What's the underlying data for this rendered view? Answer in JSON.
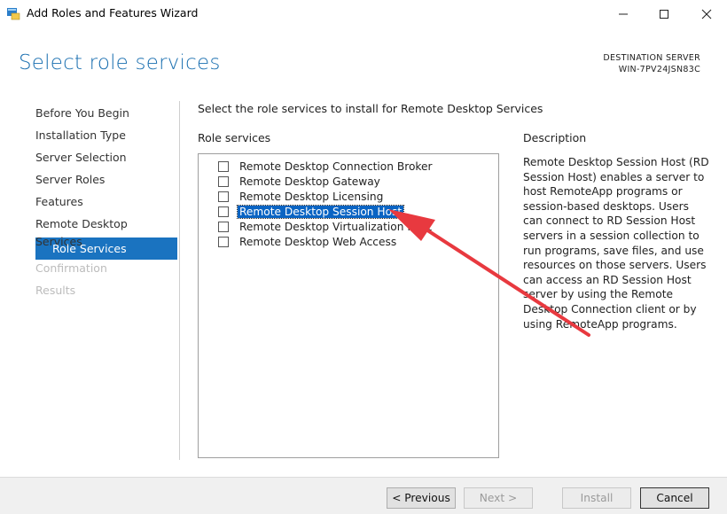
{
  "window": {
    "title": "Add Roles and Features Wizard",
    "controls": [
      "minimize-icon",
      "maximize-icon",
      "close-icon"
    ]
  },
  "page": {
    "heading": "Select role services",
    "destination_label": "DESTINATION SERVER",
    "destination_name": "WIN-7PV24JSN83C"
  },
  "nav": {
    "items": [
      {
        "label": "Before You Begin",
        "state": "normal"
      },
      {
        "label": "Installation Type",
        "state": "normal"
      },
      {
        "label": "Server Selection",
        "state": "normal"
      },
      {
        "label": "Server Roles",
        "state": "normal"
      },
      {
        "label": "Features",
        "state": "normal"
      },
      {
        "label": "Remote Desktop Services",
        "state": "normal"
      },
      {
        "label": "Role Services",
        "state": "active"
      },
      {
        "label": "Confirmation",
        "state": "disabled"
      },
      {
        "label": "Results",
        "state": "disabled"
      }
    ]
  },
  "main": {
    "instruction": "Select the role services to install for Remote Desktop Services",
    "role_services_header": "Role services",
    "role_services": [
      {
        "label": "Remote Desktop Connection Broker",
        "checked": false,
        "selected": false
      },
      {
        "label": "Remote Desktop Gateway",
        "checked": false,
        "selected": false
      },
      {
        "label": "Remote Desktop Licensing",
        "checked": false,
        "selected": false
      },
      {
        "label": "Remote Desktop Session Host",
        "checked": false,
        "selected": true
      },
      {
        "label": "Remote Desktop Virtualization Host",
        "checked": false,
        "selected": false
      },
      {
        "label": "Remote Desktop Web Access",
        "checked": false,
        "selected": false
      }
    ],
    "description_header": "Description",
    "description_text": "Remote Desktop Session Host (RD Session Host) enables a server to host RemoteApp programs or session-based desktops. Users can connect to RD Session Host servers in a session collection to run programs, save files, and use resources on those servers. Users can access an RD Session Host server by using the Remote Desktop Connection client or by using RemoteApp programs."
  },
  "footer": {
    "previous_label": "< Previous",
    "next_label": "Next >",
    "install_label": "Install",
    "cancel_label": "Cancel"
  },
  "annotation": {
    "arrow_color": "#e8393f"
  },
  "colors": {
    "accent": "#1a73c0",
    "heading": "#1a6fb0",
    "selection": "#0a64c3"
  }
}
